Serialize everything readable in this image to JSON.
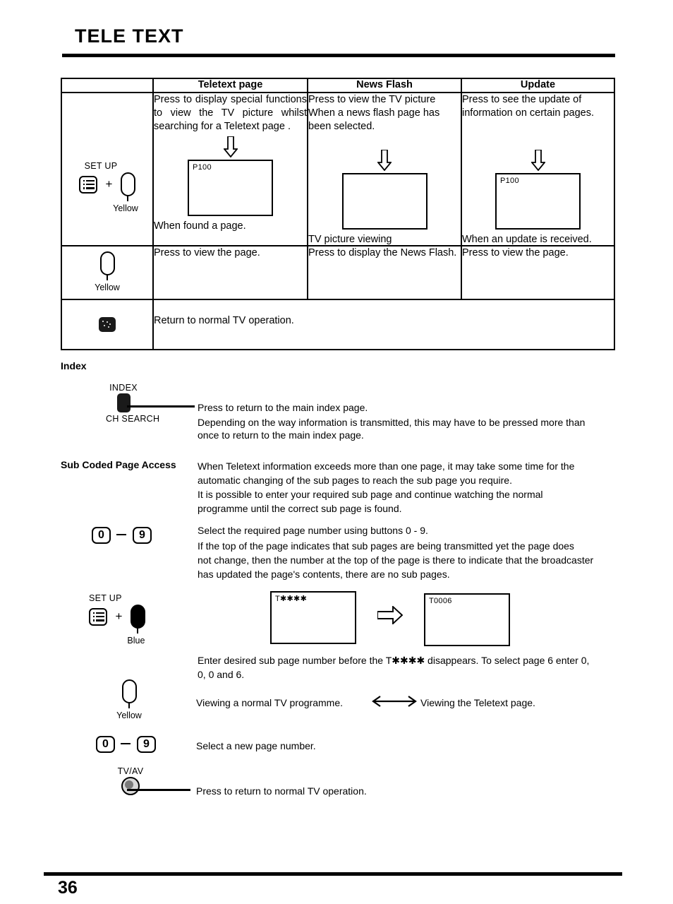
{
  "document": {
    "title": "TELE TEXT",
    "page_number": "36"
  },
  "table": {
    "headers": {
      "key_column": "",
      "col_a": "Teletext page",
      "col_b": "News Flash",
      "col_c": "Update"
    },
    "rows": [
      {
        "key": {
          "setup_label": "SET UP",
          "plus": "+",
          "colour_label": "Yellow",
          "icons": [
            "setup-icon",
            "yellow-button-icon"
          ]
        },
        "cells": [
          {
            "text": "Press  to display special functions to view the TV picture whilst searching for a Teletext page .",
            "screen_label": "P100",
            "caption": "When found a page."
          },
          {
            "text": "Press to view the TV picture When a news flash page has been selected.",
            "screen_label": "",
            "caption": "TV picture viewing"
          },
          {
            "text": "Press  to see the update of information on certain pages.",
            "screen_label": "P100",
            "caption": "When an update is received."
          }
        ]
      },
      {
        "key": {
          "setup_label": "",
          "plus": "",
          "colour_label": "Yellow",
          "icons": [
            "yellow-button-icon"
          ]
        },
        "cells": [
          {
            "text": "Press to view the page.",
            "screen_label": "",
            "caption": ""
          },
          {
            "text": "Press to display the News Flash.",
            "screen_label": "",
            "caption": ""
          },
          {
            "text": "Press to view the page.",
            "screen_label": "",
            "caption": ""
          }
        ]
      },
      {
        "key": {
          "setup_label": "",
          "plus": "",
          "colour_label": "",
          "icons": [
            "teletext-button-icon"
          ]
        },
        "cells": [
          {
            "text": "Return to normal TV operation.",
            "screen_label": "",
            "caption": ""
          }
        ]
      }
    ]
  },
  "index_section": {
    "heading": "Index",
    "button_top_label": "INDEX",
    "button_bottom_label": "CH SEARCH",
    "line1": "Press  to return to the main index page.",
    "line2": "Depending on the way information is transmitted, this may have to be pressed more than",
    "line3": "once to return to the main index page."
  },
  "sub_coded_section": {
    "heading": "Sub Coded Page Access",
    "intro_line1": "When Teletext information exceeds more than one page, it may take some time for the",
    "intro_line2": "automatic changing of the sub pages to reach the sub page you require.",
    "intro_line3": "It is possible to enter your required sub page and continue watching the normal",
    "intro_line4": "programme until the correct sub page is found.",
    "numkeys": {
      "from": "0",
      "to": "9"
    },
    "num_line1": "Select the required page number using buttons 0 - 9.",
    "num_line2": "If the top of the page indicates that sub pages are being transmitted yet the page does",
    "num_line3": "not change, then the number at the top of the page is there to indicate that the broadcaster",
    "num_line4": "has updated the page's contents, there are no sub pages.",
    "setup_label": "SET UP",
    "plus": "+",
    "blue_label": "Blue",
    "screen_before": "T✱✱✱✱",
    "screen_after": "T0006",
    "enter_line1": "Enter desired sub page number before the T✱✱✱✱ disappears. To select page 6 enter 0,",
    "enter_line2": "0, 0 and 6.",
    "yellow_label": "Yellow",
    "viewing_left": "Viewing a normal TV programme.",
    "viewing_right": "Viewing the Teletext page.",
    "numkeys2": {
      "from": "0",
      "to": "9"
    },
    "select_new_page": "Select a new page number.",
    "tvav_label": "TV/AV",
    "tvav_text": "Press to return to normal TV operation."
  }
}
